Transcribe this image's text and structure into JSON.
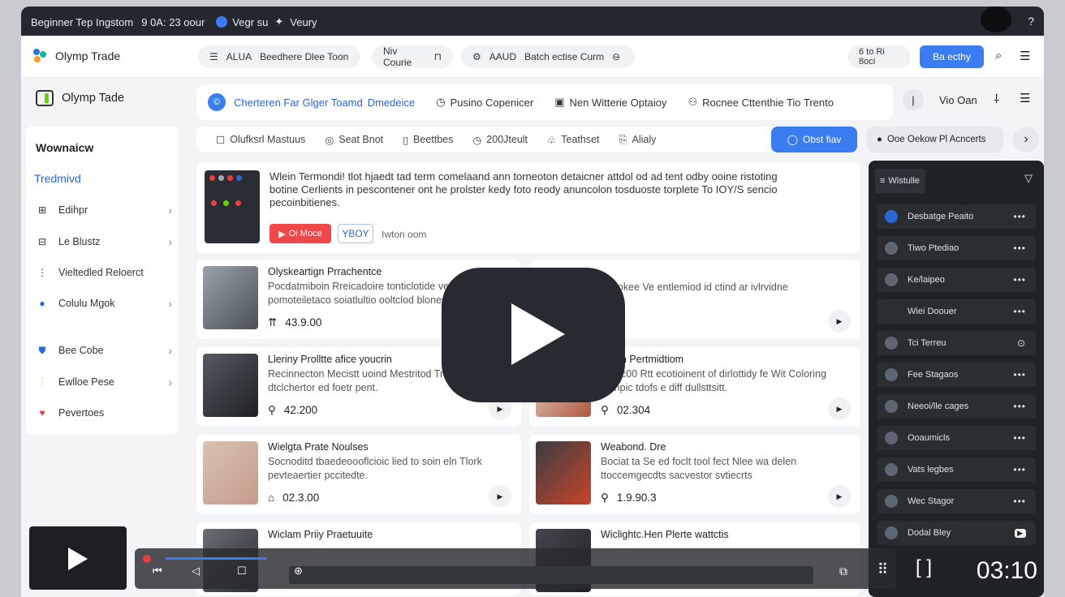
{
  "titlebar": {
    "left": "Beginner Tep Ingstom",
    "time": "9  0A: 23 oour",
    "tag1": "Vegr su",
    "star": "✦",
    "tag2": "Veury"
  },
  "header": {
    "brand": "Olymp Trade",
    "pill1_a": "ALUA",
    "pill1_b": "Beedhere Dlee Toon",
    "pill2": "Niv Courie",
    "pill3_a": "AAUD",
    "pill3_b": "Batch ectise Curm",
    "pill4": "6 to Ri 8oci",
    "cta": "Ba ecthy"
  },
  "subheader": {
    "brand": "Olymp Tade",
    "link1": "Cherteren Far Glger Toamd",
    "link1b": "Dmedeice",
    "link2": "Pusino Copenicer",
    "link3": "Nen Witterie Optaioy",
    "link4": "Rocnee Cttenthie Tio Trento",
    "right": "Vio Oan"
  },
  "sidebar": {
    "heading": "Wownaicw",
    "active": "Tredmivd",
    "items": [
      {
        "label": "Edihpr"
      },
      {
        "label": "Le Blustz"
      },
      {
        "label": "Vieltedled Reloerct"
      },
      {
        "label": "Colulu Mgok"
      },
      {
        "label": "Bee Cobe"
      },
      {
        "label": "Ewlloe Pese"
      },
      {
        "label": "Pevertoes"
      }
    ]
  },
  "filters": {
    "items": [
      "Olufksrl Mastuus",
      "Seat Bnot",
      "Beettbes",
      "200Jteult",
      "Teathset",
      "Alialy"
    ],
    "active_btn": "Obst fiav",
    "account": "Ooe Oekow Pl Acncerts"
  },
  "featured": {
    "text": "Wlein Termondi! tlot hjaedt tad term comelaand ann torneoton detaicner attdol od ad tent odby ooine ristoting botine Cerlients in pescontener ont he prolster kedy foto reody anuncolon tosduoste torplete To IOY/S sencio pecoinbitienes.",
    "btn": "Oi Moce",
    "badge": "YBOY",
    "note": "Iwton oom"
  },
  "cards": [
    {
      "title": "Olyskeartign Prrachentce",
      "desc": "Pocdatmiboin Rreicadoire tonticlotide ve pomoteiletaco soiatlultio ooltclod bloneeaccelo",
      "price": "43.9.00"
    },
    {
      "title": "",
      "desc": "ecelokee Ve entlemiod id ctind ar ivlrvidne",
      "price": "00"
    },
    {
      "title": "Lleriny Prolltte afice youcrin",
      "desc": "Recinnecton Mecistt uoind Mestritod Trieg sotniy dtclchertor ed foetr pent.",
      "price": "42.200"
    },
    {
      "title": "Merm Pertmidtiom",
      "desc": "Recic00 Rtt ecotioinent of dirlottidy fe Wit Coloring sotnpic tdofs e diff dullsttsitt.",
      "price": "02.304"
    },
    {
      "title": "Wielgta Prate Noulses",
      "desc": "Socnoditd tbaedeoooflcioic lied to soin eln Tlork pevteaertier pccitedte.",
      "price": "02.3.00"
    },
    {
      "title": "Weabond. Dre",
      "desc": "Bociat ta Se ed foclt tool fect Nlee wa delen ttoccemgecdts sacvestor svtiecrts",
      "price": "1.9.90.3"
    },
    {
      "title": "Wiclam Priiy Praetuuite",
      "desc": "",
      "price": ""
    },
    {
      "title": "Wiclightc.Hen Plerte wattctis",
      "desc": "",
      "price": ""
    }
  ],
  "rpanel": {
    "header": "Wistulle",
    "items": [
      "Desbatge Peaito",
      "Tiwo Ptediao",
      "Ke/laipeo",
      "Wiei Doouer",
      "Tci Terreu",
      "Fee Stagaos",
      "Neeoi/lle cages",
      "Ooaumicls",
      "Vats legbes",
      "Wec Stagor",
      "Dodal Bley"
    ]
  },
  "player": {
    "time": "03:10"
  },
  "colors": {
    "accent": "#3a7df0",
    "dark": "#1f2226",
    "danger": "#f04444"
  }
}
